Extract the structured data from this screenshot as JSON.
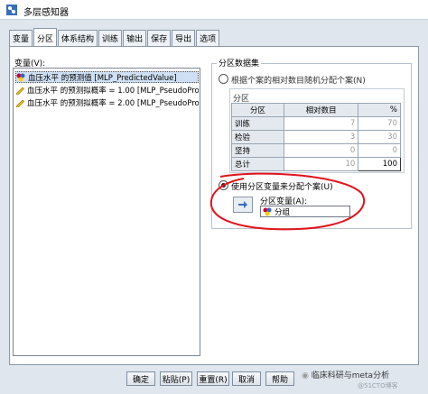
{
  "window": {
    "title": "多层感知器"
  },
  "tabs": [
    {
      "label": "变量"
    },
    {
      "label": "分区"
    },
    {
      "label": "体系结构"
    },
    {
      "label": "训练"
    },
    {
      "label": "输出"
    },
    {
      "label": "保存"
    },
    {
      "label": "导出"
    },
    {
      "label": "选项"
    }
  ],
  "active_tab": "分区",
  "variables": {
    "label": "变量(V):",
    "items": [
      {
        "label": "血压水平 的预测值 [MLP_PredictedValue]",
        "icon": "nominal-var-icon",
        "selected": true
      },
      {
        "label": "血压水平 的预测拟概率 = 1.00 [MLP_PseudoProb...",
        "icon": "scale-var-icon",
        "selected": false
      },
      {
        "label": "血压水平 的预测拟概率 = 2.00 [MLP_PseudoProb...",
        "icon": "scale-var-icon",
        "selected": false
      }
    ]
  },
  "partition": {
    "group_title": "分区数据集",
    "random_option": "根据个案的相对数目随机分配个案(N)",
    "sub_label": "分区",
    "table": {
      "headers": [
        "分区",
        "相对数目",
        "%"
      ],
      "rows": [
        {
          "name": "训练",
          "count": "7",
          "pct": "70"
        },
        {
          "name": "检验",
          "count": "3",
          "pct": "30"
        },
        {
          "name": "坚持",
          "count": "0",
          "pct": "0"
        },
        {
          "name": "总计",
          "count": "10",
          "pct": "100"
        }
      ]
    },
    "variable_option": "使用分区变量来分配个案(U)",
    "variable_field_label": "分区变量(A):",
    "variable_field_value": "分组"
  },
  "buttons": [
    {
      "label": "确定"
    },
    {
      "label": "粘贴(P)"
    },
    {
      "label": "重置(R)"
    },
    {
      "label": "取消"
    },
    {
      "label": "帮助"
    }
  ],
  "watermark": {
    "text": "临床科研与meta分析",
    "sub": "@51CTO博客"
  },
  "colors": {
    "annotation": "#e0141e",
    "accent": "#2f5fa7"
  }
}
